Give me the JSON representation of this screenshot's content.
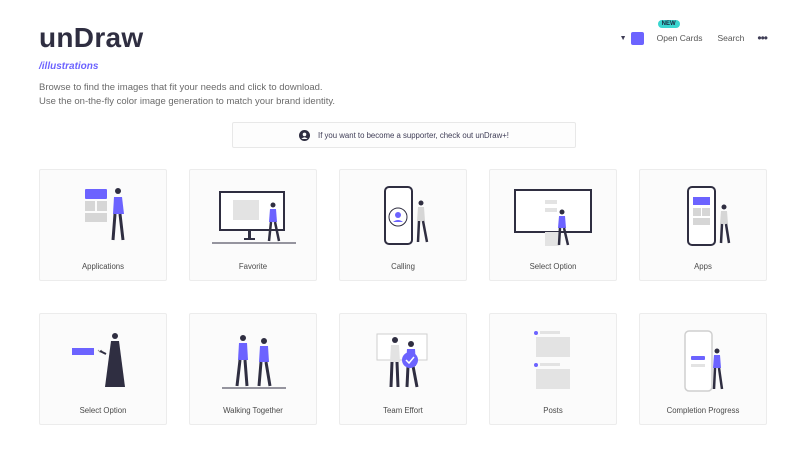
{
  "brand": {
    "logo": "unDraw",
    "tagline": "/illustrations",
    "accent_color": "#6c63ff"
  },
  "description": "Browse to find the images that fit your needs and click to download. Use the on-the-fly color image generation to match your brand identity.",
  "nav": {
    "color_caret_icon": "caret-down-icon",
    "swatch_color": "#6c63ff",
    "new_badge": "NEW",
    "open_cards": "Open Cards",
    "search": "Search",
    "more_icon": "more-dots-icon"
  },
  "banner": {
    "text": "If you want to become a supporter, check out unDraw+!",
    "icon": "supporter-avatar-icon"
  },
  "cards": [
    {
      "label": "Applications"
    },
    {
      "label": "Favorite"
    },
    {
      "label": "Calling"
    },
    {
      "label": "Select Option"
    },
    {
      "label": "Apps"
    },
    {
      "label": "Select Option"
    },
    {
      "label": "Walking Together"
    },
    {
      "label": "Team Effort"
    },
    {
      "label": "Posts"
    },
    {
      "label": "Completion Progress"
    }
  ]
}
